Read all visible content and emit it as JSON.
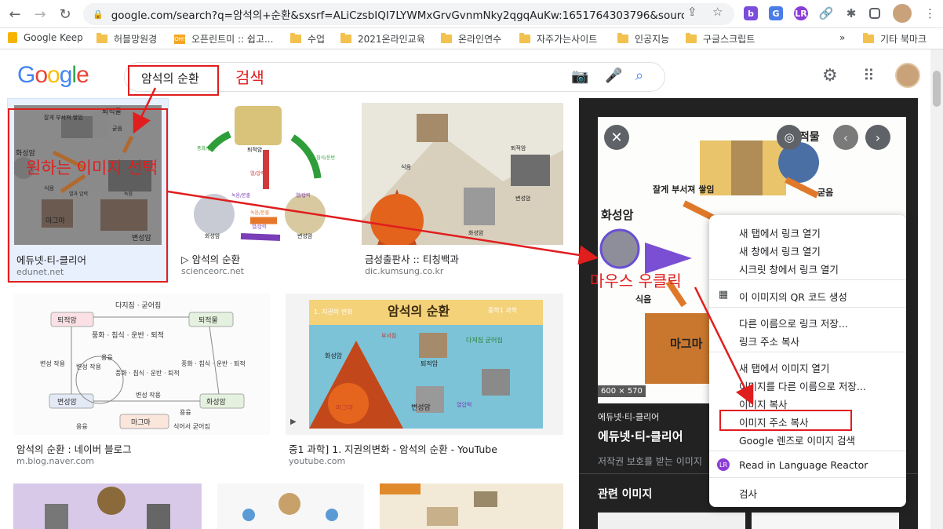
{
  "browser": {
    "url": "google.com/search?q=암석의+순환&sxsrf=ALiCzsbIQI7LYWMxGrvGvnmNky2qgqAuKw:1651764303796&source=...",
    "bookmarks": [
      "Google Keep",
      "허블망원경",
      "오픈린트미 :: 쉽고...",
      "수업",
      "2021온라인교육",
      "온라인연수",
      "자주가는사이트",
      "인공지능",
      "구글스크립트",
      "»",
      "기타 북마크"
    ]
  },
  "search": {
    "query": "암석의 순환",
    "annotation_search": "검색",
    "annotation_select": "원하는 이미지 선택",
    "annotation_rightclick": "마우스 우클릭"
  },
  "results": [
    {
      "title": "에듀넷·티-클리어",
      "source": "edunet.net"
    },
    {
      "title": "▷ 암석의 순환",
      "source": "scienceorc.net"
    },
    {
      "title": "금성출판사 :: 티칭백과",
      "source": "dic.kumsung.co.kr"
    },
    {
      "title": "암석의 순환 : 네이버 블로그",
      "source": "m.blog.naver.com"
    },
    {
      "title": "중1 과학] 1. 지권의변화 - 암석의 순환 - YouTube",
      "source": "youtube.com"
    }
  ],
  "thumb_labels": {
    "r1": [
      "퇴적물",
      "잘게 부서져 쌓임",
      "굳음",
      "화성암",
      "마그마",
      "변성암",
      "식음",
      "열과 압력",
      "녹음"
    ],
    "r2": [
      "퇴적암",
      "풍화/운반",
      "열/압력",
      "침식/운반",
      "녹음/분출",
      "열/압력",
      "화성암",
      "변성암",
      "녹음/분출",
      "열/압력"
    ],
    "r3": [
      "퇴적암",
      "식음",
      "변성암",
      "화성암"
    ],
    "r4": [
      "다지짐 · 굳어짐",
      "퇴적암",
      "퇴적물",
      "풍화 · 침식 · 운반 · 퇴적",
      "변성 작용",
      "변성 작용",
      "용융",
      "풍화 · 침식 · 운반 · 퇴적",
      "풍화 · 침식 · 운반 · 퇴적",
      "변성암",
      "변성 작용",
      "화성암",
      "마그마",
      "용융",
      "용융",
      "식어서 굳어짐"
    ],
    "r5": [
      "1. 지권의 변화",
      "암석의 순환",
      "중학1 과학",
      "부서짐",
      "퇴적암",
      "다져짐 굳어짐",
      "화성암",
      "마그마",
      "변성암",
      "열압력"
    ]
  },
  "panel": {
    "dims": "600 × 570",
    "source": "에듀넷·티-클리어",
    "title": "에듀넷·티-클리어",
    "copyright": "저작권 보호를 받는 이미지",
    "related": "관련 이미지",
    "image_labels": [
      "퇴적물",
      "잘게 부서져 쌓임",
      "굳음",
      "화성암",
      "식음",
      "마그마"
    ]
  },
  "context_menu": [
    "새 탭에서 링크 열기",
    "새 창에서 링크 열기",
    "시크릿 창에서 링크 열기",
    "이 이미지의 QR 코드 생성",
    "다른 이름으로 링크 저장...",
    "링크 주소 복사",
    "새 탭에서 이미지 열기",
    "이미지를 다른 이름으로 저장...",
    "이미지 복사",
    "이미지 주소 복사",
    "Google 렌즈로 이미지 검색",
    "Read in Language Reactor",
    "검사"
  ],
  "colors": {
    "accent_red": "#e01e1e",
    "google_blue": "#4285f4",
    "panel_bg": "#222222"
  }
}
